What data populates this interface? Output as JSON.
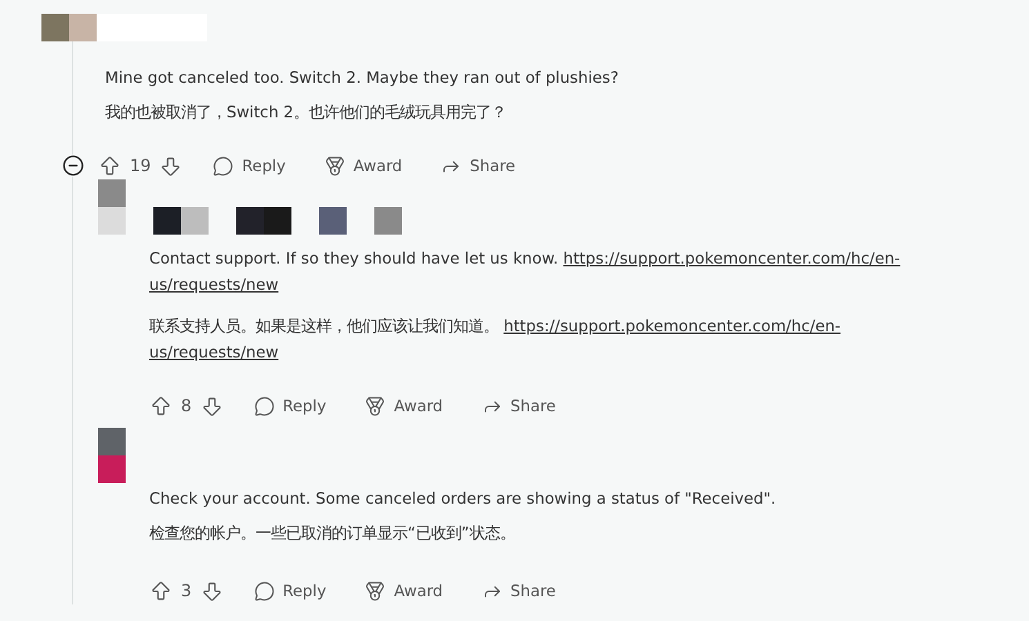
{
  "comment": {
    "paragraphs": [
      {
        "lines": [
          {
            "text": "Mine got canceled too. Switch 2. Maybe they ran out of plushies?"
          }
        ]
      },
      {
        "lines": [
          {
            "text": "我的也被取消了，Switch 2。也许他们的毛绒玩具用完了？"
          }
        ]
      }
    ],
    "collapse_button": true,
    "votes": "19",
    "actions": [
      "Reply",
      "Award",
      "Share"
    ],
    "replies": [
      {
        "name_redacted": true,
        "paragraphs": [
          {
            "lines": [
              {
                "text": "Contact support. If so they should have let us know.",
                "link": "https://support.pokemoncenter.com/hc/en-"
              },
              {
                "link": "us/requests/new"
              }
            ]
          },
          {
            "lines": [
              {
                "text": "联系支持人员。如果是这样，他们应该让我们知道。",
                "link": "https://support.pokemoncenter.com/hc/en-"
              },
              {
                "link": "us/requests/new"
              }
            ]
          }
        ],
        "collapse_button": false,
        "votes": "8",
        "actions": [
          "Reply",
          "Award",
          "Share"
        ]
      },
      {
        "name_redacted": false,
        "paragraphs": [
          {
            "lines": [
              {
                "text": "Check your account. Some canceled orders are showing a status of \"Received\"."
              }
            ]
          },
          {
            "lines": [
              {
                "text": "检查您的帐户。一些已取消的订单显示“已收到”状态。"
              }
            ]
          }
        ],
        "collapse_button": false,
        "votes": "3",
        "actions": [
          "Reply",
          "Award",
          "Share"
        ]
      }
    ]
  }
}
